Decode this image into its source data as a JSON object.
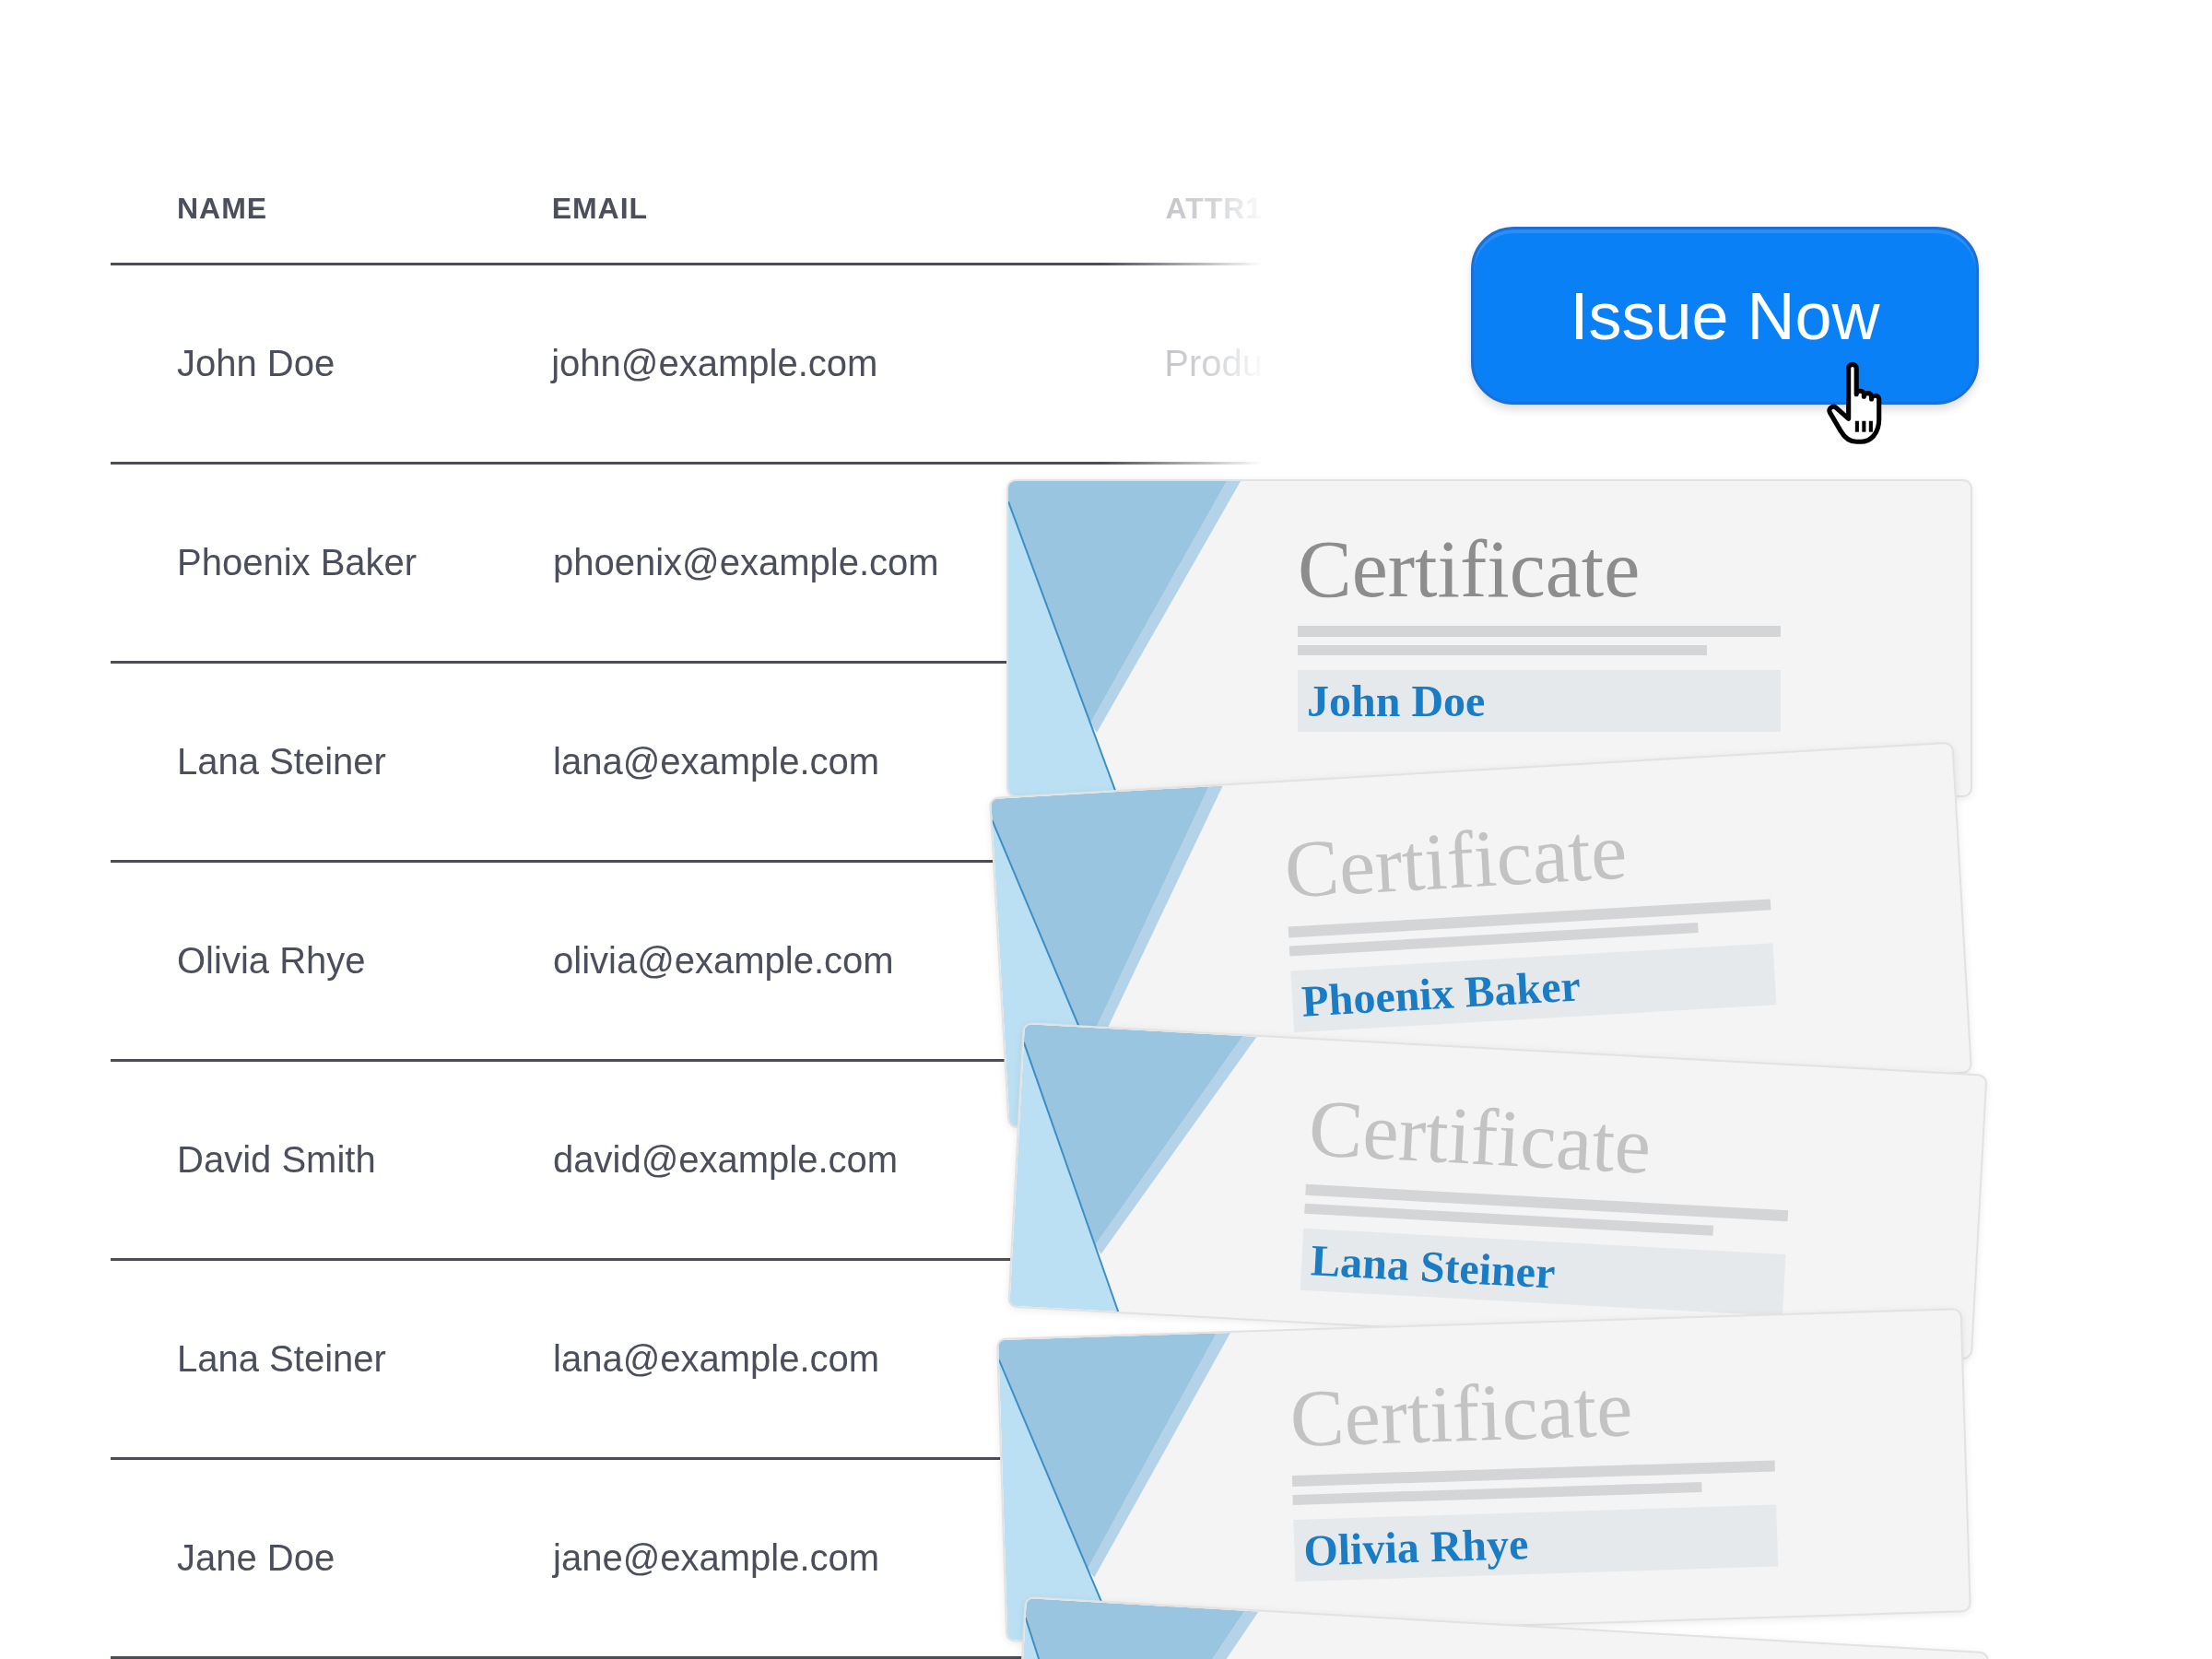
{
  "table": {
    "columns": [
      "NAME",
      "EMAIL",
      "ATTR1"
    ],
    "rows": [
      {
        "cells": [
          "John Doe",
          "john@example.com",
          "Produ"
        ]
      },
      {
        "cells": [
          "Phoenix Baker",
          "phoenix@example.com"
        ]
      },
      {
        "cells": [
          "Lana Steiner",
          "lana@example.com"
        ]
      },
      {
        "cells": [
          "Olivia Rhye",
          "olivia@example.com"
        ]
      },
      {
        "cells": [
          "David Smith",
          "david@example.com"
        ]
      },
      {
        "cells": [
          "Lana Steiner",
          "lana@example.com"
        ]
      },
      {
        "cells": [
          "Jane Doe",
          "jane@example.com"
        ]
      }
    ]
  },
  "issue_button": {
    "label": "Issue Now"
  },
  "certificates": [
    {
      "kind": "full",
      "title": "Certificate",
      "name": "John Doe"
    },
    {
      "kind": "full",
      "title": "Certificate",
      "name": "Phoenix Baker"
    },
    {
      "kind": "full",
      "title": "Certificate",
      "name": "Lana Steiner"
    },
    {
      "kind": "full",
      "title": "Certificate",
      "name": "Olivia Rhye"
    },
    {
      "kind": "partial"
    }
  ]
}
